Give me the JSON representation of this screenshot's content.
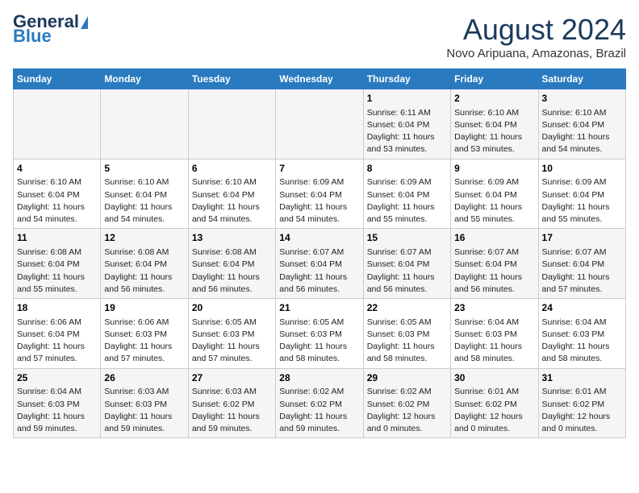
{
  "header": {
    "logo_line1": "General",
    "logo_line2": "Blue",
    "month": "August 2024",
    "location": "Novo Aripuana, Amazonas, Brazil"
  },
  "weekdays": [
    "Sunday",
    "Monday",
    "Tuesday",
    "Wednesday",
    "Thursday",
    "Friday",
    "Saturday"
  ],
  "weeks": [
    [
      {
        "day": "",
        "info": ""
      },
      {
        "day": "",
        "info": ""
      },
      {
        "day": "",
        "info": ""
      },
      {
        "day": "",
        "info": ""
      },
      {
        "day": "1",
        "info": "Sunrise: 6:11 AM\nSunset: 6:04 PM\nDaylight: 11 hours\nand 53 minutes."
      },
      {
        "day": "2",
        "info": "Sunrise: 6:10 AM\nSunset: 6:04 PM\nDaylight: 11 hours\nand 53 minutes."
      },
      {
        "day": "3",
        "info": "Sunrise: 6:10 AM\nSunset: 6:04 PM\nDaylight: 11 hours\nand 54 minutes."
      }
    ],
    [
      {
        "day": "4",
        "info": "Sunrise: 6:10 AM\nSunset: 6:04 PM\nDaylight: 11 hours\nand 54 minutes."
      },
      {
        "day": "5",
        "info": "Sunrise: 6:10 AM\nSunset: 6:04 PM\nDaylight: 11 hours\nand 54 minutes."
      },
      {
        "day": "6",
        "info": "Sunrise: 6:10 AM\nSunset: 6:04 PM\nDaylight: 11 hours\nand 54 minutes."
      },
      {
        "day": "7",
        "info": "Sunrise: 6:09 AM\nSunset: 6:04 PM\nDaylight: 11 hours\nand 54 minutes."
      },
      {
        "day": "8",
        "info": "Sunrise: 6:09 AM\nSunset: 6:04 PM\nDaylight: 11 hours\nand 55 minutes."
      },
      {
        "day": "9",
        "info": "Sunrise: 6:09 AM\nSunset: 6:04 PM\nDaylight: 11 hours\nand 55 minutes."
      },
      {
        "day": "10",
        "info": "Sunrise: 6:09 AM\nSunset: 6:04 PM\nDaylight: 11 hours\nand 55 minutes."
      }
    ],
    [
      {
        "day": "11",
        "info": "Sunrise: 6:08 AM\nSunset: 6:04 PM\nDaylight: 11 hours\nand 55 minutes."
      },
      {
        "day": "12",
        "info": "Sunrise: 6:08 AM\nSunset: 6:04 PM\nDaylight: 11 hours\nand 56 minutes."
      },
      {
        "day": "13",
        "info": "Sunrise: 6:08 AM\nSunset: 6:04 PM\nDaylight: 11 hours\nand 56 minutes."
      },
      {
        "day": "14",
        "info": "Sunrise: 6:07 AM\nSunset: 6:04 PM\nDaylight: 11 hours\nand 56 minutes."
      },
      {
        "day": "15",
        "info": "Sunrise: 6:07 AM\nSunset: 6:04 PM\nDaylight: 11 hours\nand 56 minutes."
      },
      {
        "day": "16",
        "info": "Sunrise: 6:07 AM\nSunset: 6:04 PM\nDaylight: 11 hours\nand 56 minutes."
      },
      {
        "day": "17",
        "info": "Sunrise: 6:07 AM\nSunset: 6:04 PM\nDaylight: 11 hours\nand 57 minutes."
      }
    ],
    [
      {
        "day": "18",
        "info": "Sunrise: 6:06 AM\nSunset: 6:04 PM\nDaylight: 11 hours\nand 57 minutes."
      },
      {
        "day": "19",
        "info": "Sunrise: 6:06 AM\nSunset: 6:03 PM\nDaylight: 11 hours\nand 57 minutes."
      },
      {
        "day": "20",
        "info": "Sunrise: 6:05 AM\nSunset: 6:03 PM\nDaylight: 11 hours\nand 57 minutes."
      },
      {
        "day": "21",
        "info": "Sunrise: 6:05 AM\nSunset: 6:03 PM\nDaylight: 11 hours\nand 58 minutes."
      },
      {
        "day": "22",
        "info": "Sunrise: 6:05 AM\nSunset: 6:03 PM\nDaylight: 11 hours\nand 58 minutes."
      },
      {
        "day": "23",
        "info": "Sunrise: 6:04 AM\nSunset: 6:03 PM\nDaylight: 11 hours\nand 58 minutes."
      },
      {
        "day": "24",
        "info": "Sunrise: 6:04 AM\nSunset: 6:03 PM\nDaylight: 11 hours\nand 58 minutes."
      }
    ],
    [
      {
        "day": "25",
        "info": "Sunrise: 6:04 AM\nSunset: 6:03 PM\nDaylight: 11 hours\nand 59 minutes."
      },
      {
        "day": "26",
        "info": "Sunrise: 6:03 AM\nSunset: 6:03 PM\nDaylight: 11 hours\nand 59 minutes."
      },
      {
        "day": "27",
        "info": "Sunrise: 6:03 AM\nSunset: 6:02 PM\nDaylight: 11 hours\nand 59 minutes."
      },
      {
        "day": "28",
        "info": "Sunrise: 6:02 AM\nSunset: 6:02 PM\nDaylight: 11 hours\nand 59 minutes."
      },
      {
        "day": "29",
        "info": "Sunrise: 6:02 AM\nSunset: 6:02 PM\nDaylight: 12 hours\nand 0 minutes."
      },
      {
        "day": "30",
        "info": "Sunrise: 6:01 AM\nSunset: 6:02 PM\nDaylight: 12 hours\nand 0 minutes."
      },
      {
        "day": "31",
        "info": "Sunrise: 6:01 AM\nSunset: 6:02 PM\nDaylight: 12 hours\nand 0 minutes."
      }
    ]
  ]
}
